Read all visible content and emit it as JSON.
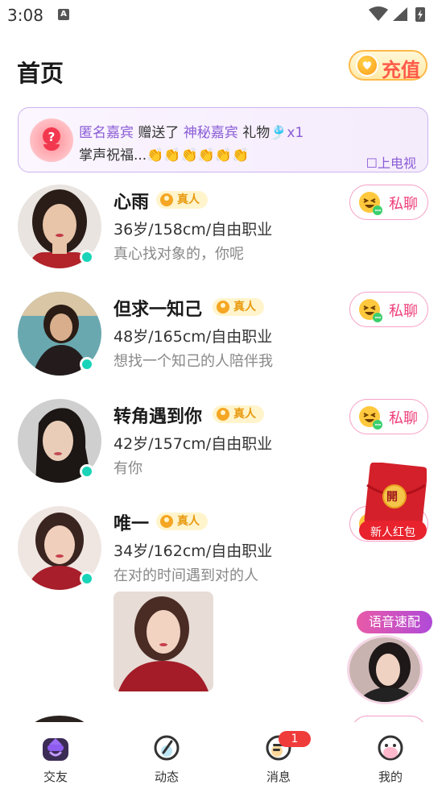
{
  "status_bar": {
    "time": "3:08"
  },
  "header": {
    "title": "首页",
    "recharge_label": "充值"
  },
  "gift_banner": {
    "sender": "匿名嘉宾",
    "verb": "赠送了",
    "receiver": "神秘嘉宾",
    "gift_word": "礼物",
    "gift_emoji": "🎐",
    "count": "x1",
    "gift_name": "掌声祝福...",
    "claps": "👏👏👏👏👏👏",
    "tv_label": "上电视",
    "colors": {
      "accent": "#8a5cd6"
    }
  },
  "profiles": [
    {
      "name": "心雨",
      "badge": "真人",
      "info": "36岁/158cm/自由职业",
      "bio": " 真心找对象的，你呢",
      "chat_label": "私聊",
      "online": true
    },
    {
      "name": "但求一知己",
      "badge": "真人",
      "info": "48岁/165cm/自由职业",
      "bio": "想找一个知己的人陪伴我",
      "chat_label": "私聊",
      "online": true
    },
    {
      "name": "转角遇到你",
      "badge": "真人",
      "info": "42岁/157cm/自由职业",
      "bio": "有你",
      "chat_label": "私聊",
      "online": true
    },
    {
      "name": "唯一",
      "badge": "真人",
      "info": "34岁/162cm/自由职业",
      "bio": "在对的时间遇到对的人",
      "chat_label": "私聊",
      "online": true
    }
  ],
  "floating": {
    "red_packet_label": "新人红包",
    "red_packet_char": "開",
    "voice_match_label": "语音速配"
  },
  "bottom_nav": {
    "items": [
      {
        "label": "交友",
        "icon": "friends-icon",
        "active": true
      },
      {
        "label": "动态",
        "icon": "compass-icon"
      },
      {
        "label": "消息",
        "icon": "message-icon",
        "badge": "1"
      },
      {
        "label": "我的",
        "icon": "profile-icon"
      }
    ]
  }
}
